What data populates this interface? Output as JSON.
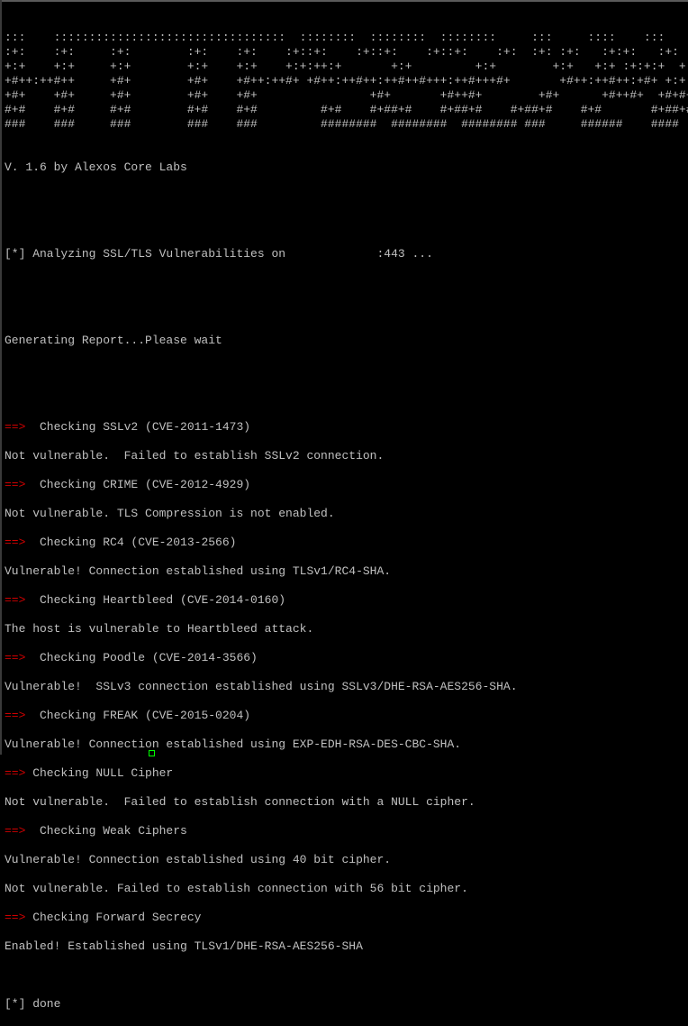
{
  "window": {
    "type": "terminal"
  },
  "colors": {
    "background": "#000000",
    "text": "#c0c0c0",
    "arrow": "#d00000",
    "cursor": "#00ff00"
  },
  "banner": [
    ":::    :::::::::::::::::::::::::::::::::  ::::::::  ::::::::  ::::::::     :::     ::::    :::",
    ":+:    :+:     :+:        :+:    :+:    :+::+:    :+::+:    :+::+:    :+:  :+: :+:   :+:+:   :+:",
    "+:+    +:+     +:+        +:+    +:+    +:+:++:+       +:+         +:+        +:+   +:+ :+:+:+  +:+",
    "+#++:++#++     +#+        +#+    +#++:++#+ +#++:++#++:++#++#+++:++#+++#+       +#++:++#++:+#+ +:+ +#+",
    "+#+    +#+     +#+        +#+    +#+                +#+       +#++#+        +#+      +#++#+  +#+#+#",
    "#+#    #+#     #+#        #+#    #+#         #+#    #+##+#    #+##+#    #+##+#    #+#       #+##+#   #+#+#",
    "###    ###     ###        ###    ###         ########  ########  ######## ###     ######    ####"
  ],
  "version_line": "V. 1.6 by Alexos Core Labs",
  "analyzing": {
    "prefix": "[*] Analyzing SSL/TLS Vulnerabilities on ",
    "host_redacted": "            ",
    "suffix": ":443 ..."
  },
  "generating": "Generating Report...Please wait",
  "arrow_glyph": "==>",
  "checks": [
    {
      "title": "  Checking SSLv2 (CVE-2011-1473)",
      "results": [
        "Not vulnerable.  Failed to establish SSLv2 connection."
      ]
    },
    {
      "title": "  Checking CRIME (CVE-2012-4929)",
      "results": [
        "Not vulnerable. TLS Compression is not enabled."
      ]
    },
    {
      "title": "  Checking RC4 (CVE-2013-2566)",
      "results": [
        "Vulnerable! Connection established using TLSv1/RC4-SHA."
      ]
    },
    {
      "title": "  Checking Heartbleed (CVE-2014-0160)",
      "results": [
        "The host is vulnerable to Heartbleed attack."
      ]
    },
    {
      "title": "  Checking Poodle (CVE-2014-3566)",
      "results": [
        "Vulnerable!  SSLv3 connection established using SSLv3/DHE-RSA-AES256-SHA."
      ]
    },
    {
      "title": "  Checking FREAK (CVE-2015-0204)",
      "results": [
        "Vulnerable! Connection established using EXP-EDH-RSA-DES-CBC-SHA."
      ]
    },
    {
      "title": " Checking NULL Cipher",
      "results": [
        "Not vulnerable.  Failed to establish connection with a NULL cipher."
      ]
    },
    {
      "title": "  Checking Weak Ciphers",
      "results": [
        "Vulnerable! Connection established using 40 bit cipher.",
        "Not vulnerable. Failed to establish connection with 56 bit cipher."
      ]
    },
    {
      "title": " Checking Forward Secrecy",
      "results": [
        "Enabled! Established using TLSv1/DHE-RSA-AES256-SHA"
      ]
    }
  ],
  "done_line": "[*] done"
}
